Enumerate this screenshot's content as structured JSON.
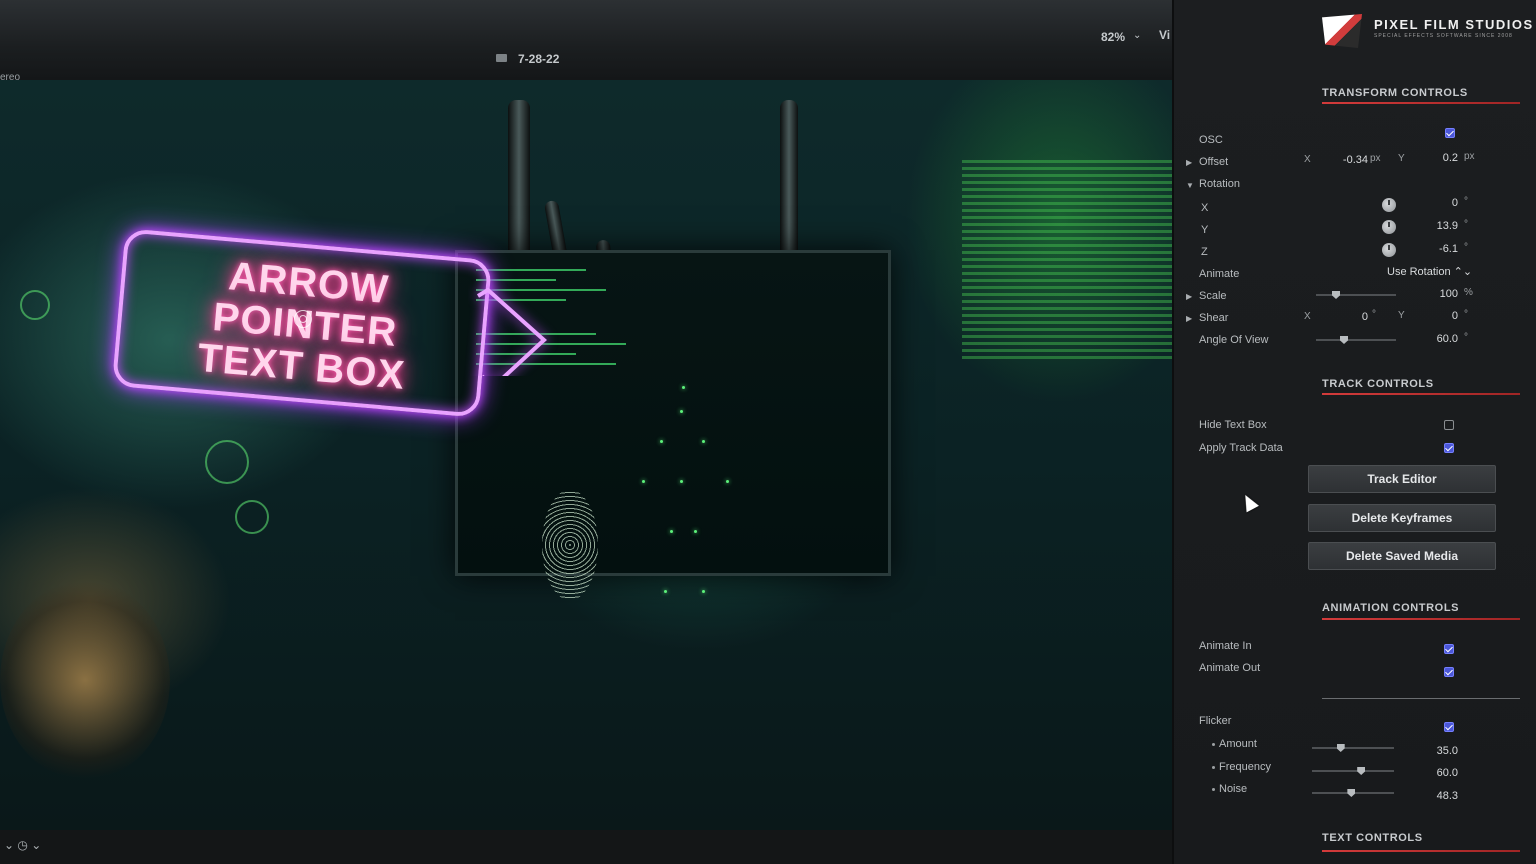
{
  "viewer": {
    "left_label": "ereo",
    "clip_name": "7-28-22",
    "zoom": "82%",
    "view_menu": "Vi",
    "title_text": "ARROW POINTER\nTEXT BOX",
    "bottom_icons": "⌄ ◷ ⌄"
  },
  "brand": {
    "name": "PIXEL FILM STUDIOS",
    "subtitle": "SPECIAL EFFECTS SOFTWARE SINCE 2008"
  },
  "transform": {
    "title": "TRANSFORM CONTROLS",
    "osc_label": "OSC",
    "osc_checked": true,
    "offset_label": "Offset",
    "offset_x_label": "X",
    "offset_x": "-0.34",
    "offset_y_label": "Y",
    "offset_y": "0.2",
    "px": "px",
    "rotation_label": "Rotation",
    "rot_x_label": "X",
    "rot_x": "0",
    "rot_y_label": "Y",
    "rot_y": "13.9",
    "rot_z_label": "Z",
    "rot_z": "-6.1",
    "deg": "°",
    "animate_label": "Animate",
    "animate_value": "Use Rotation ⌃⌄",
    "scale_label": "Scale",
    "scale_value": "100",
    "pct": "%",
    "scale_level": 0.25,
    "shear_label": "Shear",
    "shear_x_label": "X",
    "shear_x": "0",
    "shear_y_label": "Y",
    "shear_y": "0",
    "aov_label": "Angle Of View",
    "aov_value": "60.0",
    "aov_level": 0.35
  },
  "track": {
    "title": "TRACK CONTROLS",
    "hide_label": "Hide Text Box",
    "hide_checked": false,
    "apply_label": "Apply Track Data",
    "apply_checked": true,
    "track_editor": "Track Editor",
    "delete_keyframes": "Delete Keyframes",
    "delete_saved_media": "Delete Saved Media"
  },
  "animation": {
    "title": "ANIMATION CONTROLS",
    "animate_in_label": "Animate In",
    "animate_in_checked": true,
    "animate_out_label": "Animate Out",
    "animate_out_checked": true,
    "flicker_label": "Flicker",
    "flicker_checked": true,
    "amount_label": "Amount",
    "amount_value": "35.0",
    "amount_level": 0.35,
    "frequency_label": "Frequency",
    "frequency_value": "60.0",
    "frequency_level": 0.6,
    "noise_label": "Noise",
    "noise_value": "48.3",
    "noise_level": 0.48
  },
  "text_controls": {
    "title": "TEXT CONTROLS"
  },
  "colors": {
    "accent_red": "#d33b3b",
    "checkbox_blue": "#4b57d8",
    "neon_pink": "#ff3c8f",
    "neon_purple": "#c24bff"
  }
}
